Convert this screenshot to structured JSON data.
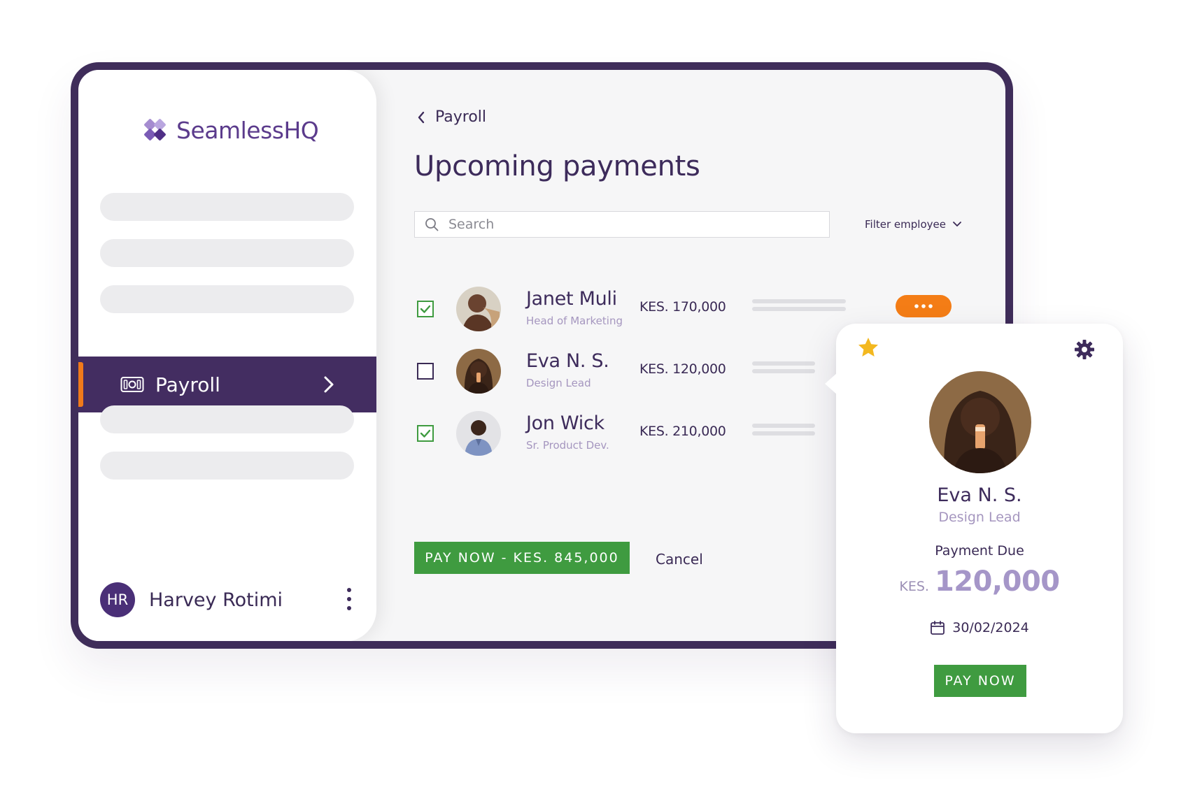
{
  "brand": {
    "name": "SeamlessHQ"
  },
  "sidebar": {
    "active_item": "Payroll",
    "user_initials": "HR",
    "user_name": "Harvey Rotimi"
  },
  "header": {
    "back_label": "Payroll",
    "title": "Upcoming payments"
  },
  "search": {
    "placeholder": "Search"
  },
  "filter": {
    "label": "Filter employee"
  },
  "employees": [
    {
      "name": "Janet Muli",
      "role": "Head of Marketing",
      "amount": "KES. 170,000",
      "checked": true
    },
    {
      "name": "Eva N. S.",
      "role": "Design Lead",
      "amount": "KES. 120,000",
      "checked": false
    },
    {
      "name": "Jon Wick",
      "role": "Sr. Product Dev.",
      "amount": "KES. 210,000",
      "checked": true
    }
  ],
  "actions": {
    "pay_now": "PAY NOW - KES. 845,000",
    "cancel": "Cancel"
  },
  "card": {
    "name": "Eva N. S.",
    "role": "Design Lead",
    "due_label": "Payment Due",
    "currency": "KES.",
    "amount": "120,000",
    "date": "30/02/2024",
    "pay_label": "PAY NOW"
  },
  "colors": {
    "brand": "#432d61",
    "accent": "#f07a1a",
    "success": "#3f9b40"
  }
}
